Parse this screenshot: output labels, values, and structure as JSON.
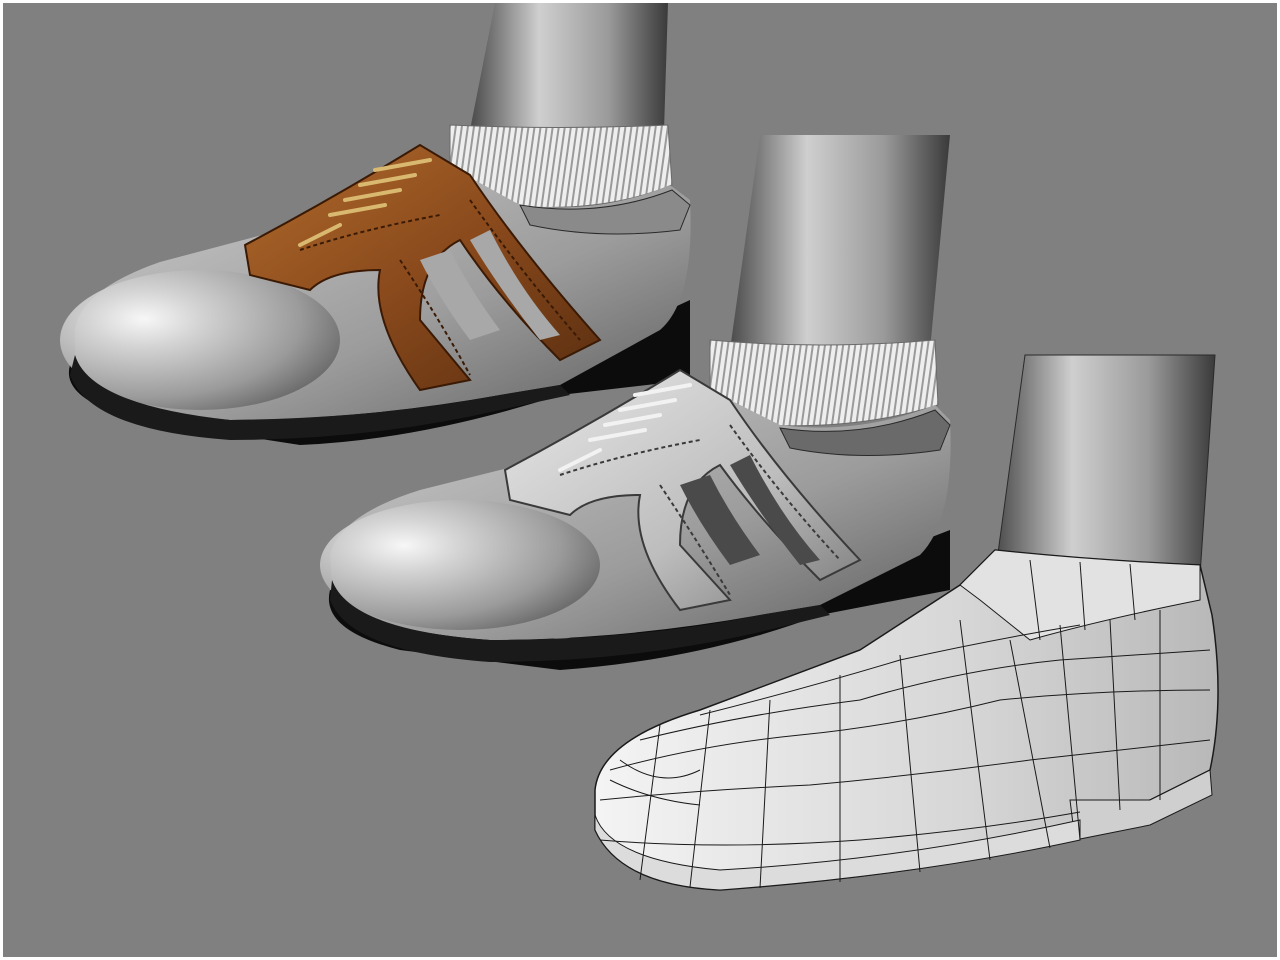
{
  "scene": {
    "description_visible_text": "",
    "background_color": "#808080",
    "frame_color": "#ffffff",
    "models": [
      {
        "name": "textured-saddle-shoe",
        "shading": "textured",
        "accent_color": "#8a4a1c",
        "lace_color": "#d9b870"
      },
      {
        "name": "grayscale-saddle-shoe",
        "shading": "smooth-grayscale",
        "accent_color": "#c8c8c8",
        "lace_color": "#f2f2f2"
      },
      {
        "name": "wireframe-shoe",
        "shading": "wireframe-on-shaded",
        "accent_color": "#e8e8e8",
        "lace_color": ""
      }
    ]
  }
}
